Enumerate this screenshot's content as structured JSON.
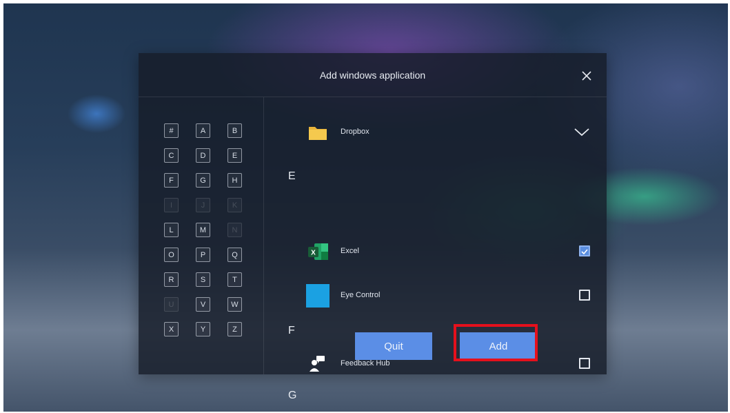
{
  "dialog": {
    "title": "Add windows application",
    "close_icon": "close-icon"
  },
  "alphabet": [
    {
      "letter": "#",
      "enabled": true
    },
    {
      "letter": "A",
      "enabled": true
    },
    {
      "letter": "B",
      "enabled": true
    },
    {
      "letter": "C",
      "enabled": true
    },
    {
      "letter": "D",
      "enabled": true
    },
    {
      "letter": "E",
      "enabled": true
    },
    {
      "letter": "F",
      "enabled": true
    },
    {
      "letter": "G",
      "enabled": true
    },
    {
      "letter": "H",
      "enabled": true
    },
    {
      "letter": "I",
      "enabled": false
    },
    {
      "letter": "J",
      "enabled": false
    },
    {
      "letter": "K",
      "enabled": false
    },
    {
      "letter": "L",
      "enabled": true
    },
    {
      "letter": "M",
      "enabled": true
    },
    {
      "letter": "N",
      "enabled": false
    },
    {
      "letter": "O",
      "enabled": true
    },
    {
      "letter": "P",
      "enabled": true
    },
    {
      "letter": "Q",
      "enabled": true
    },
    {
      "letter": "R",
      "enabled": true
    },
    {
      "letter": "S",
      "enabled": true
    },
    {
      "letter": "T",
      "enabled": true
    },
    {
      "letter": "U",
      "enabled": false
    },
    {
      "letter": "V",
      "enabled": true
    },
    {
      "letter": "W",
      "enabled": true
    },
    {
      "letter": "X",
      "enabled": true
    },
    {
      "letter": "Y",
      "enabled": true
    },
    {
      "letter": "Z",
      "enabled": true
    }
  ],
  "apps": {
    "dropbox": {
      "name": "Dropbox",
      "icon": "folder-icon",
      "control": "chevron-down-icon"
    },
    "group_e": "E",
    "excel": {
      "name": "Excel",
      "icon": "excel-icon",
      "checked": true
    },
    "eye_control": {
      "name": "Eye Control",
      "icon": "eye-control-icon",
      "checked": false
    },
    "group_f": "F",
    "feedback_hub": {
      "name": "Feedback Hub",
      "icon": "feedback-hub-icon",
      "checked": false
    },
    "group_g": "G"
  },
  "buttons": {
    "quit": "Quit",
    "add": "Add"
  },
  "colors": {
    "button": "#5b8ee6",
    "checkbox_checked": "#5b8fe0",
    "highlight": "#e5101c"
  }
}
